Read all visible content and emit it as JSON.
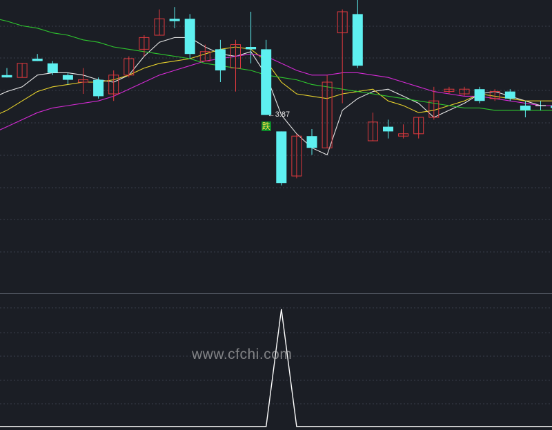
{
  "watermark": "www.cfchi.com",
  "colors": {
    "background": "#1b1e25",
    "grid": "#3a3f4a",
    "up": "#e0393e",
    "down": "#5ef0f0",
    "ma_white": "#e8e8e8",
    "ma_yellow": "#e8d22c",
    "ma_magenta": "#d62ad6",
    "ma_green": "#2ec82e",
    "signal_line": "#ffffff",
    "badge_bg": "#0a8a2a",
    "badge_text": "#ffe14a"
  },
  "chart_data": [
    {
      "type": "candlestick",
      "title": "",
      "ylim": [
        3.4,
        4.65
      ],
      "low_annotation": {
        "text": "3.87",
        "candle_index": 17
      },
      "signal_badge": {
        "text": "跌",
        "candle_index": 17
      },
      "candles": [
        {
          "o": 4.33,
          "c": 4.32,
          "h": 4.36,
          "l": 4.32
        },
        {
          "o": 4.32,
          "c": 4.38,
          "h": 4.38,
          "l": 4.32
        },
        {
          "o": 4.4,
          "c": 4.39,
          "h": 4.42,
          "l": 4.39
        },
        {
          "o": 4.38,
          "c": 4.34,
          "h": 4.39,
          "l": 4.33
        },
        {
          "o": 4.33,
          "c": 4.31,
          "h": 4.34,
          "l": 4.29
        },
        {
          "o": 4.3,
          "c": 4.31,
          "h": 4.36,
          "l": 4.25
        },
        {
          "o": 4.31,
          "c": 4.24,
          "h": 4.32,
          "l": 4.23
        },
        {
          "o": 4.25,
          "c": 4.33,
          "h": 4.35,
          "l": 4.22
        },
        {
          "o": 4.33,
          "c": 4.4,
          "h": 4.41,
          "l": 4.32
        },
        {
          "o": 4.44,
          "c": 4.49,
          "h": 4.5,
          "l": 4.41
        },
        {
          "o": 4.5,
          "c": 4.57,
          "h": 4.61,
          "l": 4.5
        },
        {
          "o": 4.57,
          "c": 4.56,
          "h": 4.62,
          "l": 4.53
        },
        {
          "o": 4.57,
          "c": 4.42,
          "h": 4.59,
          "l": 4.4
        },
        {
          "o": 4.39,
          "c": 4.43,
          "h": 4.46,
          "l": 4.39
        },
        {
          "o": 4.44,
          "c": 4.35,
          "h": 4.48,
          "l": 4.3
        },
        {
          "o": 4.36,
          "c": 4.46,
          "h": 4.48,
          "l": 4.26
        },
        {
          "o": 4.45,
          "c": 4.44,
          "h": 4.6,
          "l": 4.38
        },
        {
          "o": 4.44,
          "c": 4.16,
          "h": 4.48,
          "l": 4.16
        },
        {
          "o": 4.09,
          "c": 3.87,
          "h": 4.09,
          "l": 3.86
        },
        {
          "o": 3.9,
          "c": 4.07,
          "h": 4.08,
          "l": 3.89
        },
        {
          "o": 4.07,
          "c": 4.02,
          "h": 4.1,
          "l": 3.99
        },
        {
          "o": 4.02,
          "c": 4.3,
          "h": 4.33,
          "l": 4.02
        },
        {
          "o": 4.51,
          "c": 4.6,
          "h": 4.61,
          "l": 4.21
        },
        {
          "o": 4.59,
          "c": 4.37,
          "h": 4.65,
          "l": 4.36
        },
        {
          "o": 4.05,
          "c": 4.13,
          "h": 4.17,
          "l": 4.05
        },
        {
          "o": 4.11,
          "c": 4.09,
          "h": 4.14,
          "l": 4.06
        },
        {
          "o": 4.07,
          "c": 4.08,
          "h": 4.12,
          "l": 4.06
        },
        {
          "o": 4.08,
          "c": 4.15,
          "h": 4.15,
          "l": 4.06
        },
        {
          "o": 4.15,
          "c": 4.22,
          "h": 4.28,
          "l": 4.14
        },
        {
          "o": 4.26,
          "c": 4.27,
          "h": 4.28,
          "l": 4.25
        },
        {
          "o": 4.25,
          "c": 4.27,
          "h": 4.28,
          "l": 4.24
        },
        {
          "o": 4.27,
          "c": 4.22,
          "h": 4.28,
          "l": 4.21
        },
        {
          "o": 4.23,
          "c": 4.26,
          "h": 4.27,
          "l": 4.22
        },
        {
          "o": 4.26,
          "c": 4.23,
          "h": 4.27,
          "l": 4.22
        },
        {
          "o": 4.2,
          "c": 4.18,
          "h": 4.22,
          "l": 4.15
        },
        {
          "o": 4.2,
          "c": 4.2,
          "h": 4.22,
          "l": 4.18
        },
        {
          "o": 4.2,
          "c": 4.19,
          "h": 4.21,
          "l": 4.18
        }
      ],
      "moving_averages": [
        {
          "name": "",
          "color": "#e8e8e8",
          "values": [
            4.26,
            4.28,
            4.33,
            4.34,
            4.34,
            4.33,
            4.31,
            4.3,
            4.33,
            4.41,
            4.47,
            4.49,
            4.49,
            4.45,
            4.42,
            4.41,
            4.43,
            4.33,
            4.16,
            4.08,
            4.02,
            3.99,
            4.18,
            4.23,
            4.26,
            4.27,
            4.24,
            4.21,
            4.15,
            4.18,
            4.21,
            4.25,
            4.26,
            4.24,
            4.22,
            4.2,
            4.2
          ]
        },
        {
          "name": "",
          "color": "#e8d22c",
          "values": [
            4.18,
            4.22,
            4.26,
            4.28,
            4.29,
            4.3,
            4.3,
            4.31,
            4.33,
            4.36,
            4.38,
            4.39,
            4.4,
            4.42,
            4.44,
            4.45,
            4.44,
            4.39,
            4.3,
            4.25,
            4.24,
            4.23,
            4.25,
            4.26,
            4.27,
            4.22,
            4.2,
            4.17,
            4.18,
            4.2,
            4.22,
            4.25,
            4.24,
            4.23,
            4.22,
            4.22,
            4.22
          ]
        },
        {
          "name": "",
          "color": "#d62ad6",
          "values": [
            4.11,
            4.14,
            4.17,
            4.19,
            4.2,
            4.21,
            4.22,
            4.24,
            4.27,
            4.3,
            4.33,
            4.35,
            4.37,
            4.39,
            4.4,
            4.41,
            4.42,
            4.41,
            4.38,
            4.35,
            4.33,
            4.33,
            4.34,
            4.34,
            4.33,
            4.32,
            4.3,
            4.28,
            4.26,
            4.25,
            4.24,
            4.24,
            4.23,
            4.22,
            4.21,
            4.2,
            4.2
          ]
        },
        {
          "name": "",
          "color": "#2ec82e",
          "values": [
            4.56,
            4.54,
            4.53,
            4.51,
            4.5,
            4.48,
            4.47,
            4.45,
            4.44,
            4.43,
            4.42,
            4.41,
            4.4,
            4.38,
            4.37,
            4.36,
            4.35,
            4.33,
            4.32,
            4.31,
            4.29,
            4.28,
            4.27,
            4.26,
            4.25,
            4.24,
            4.23,
            4.22,
            4.21,
            4.2,
            4.19,
            4.19,
            4.18,
            4.18,
            4.18,
            4.18,
            4.18
          ]
        }
      ]
    },
    {
      "type": "line",
      "title": "",
      "ylim": [
        0,
        1
      ],
      "series": [
        {
          "name": "",
          "color": "#ffffff",
          "values": [
            0,
            0,
            0,
            0,
            0,
            0,
            0,
            0,
            0,
            0,
            0,
            0,
            0,
            0,
            0,
            0,
            0,
            0,
            1,
            0,
            0,
            0,
            0,
            0,
            0,
            0,
            0,
            0,
            0,
            0,
            0,
            0,
            0,
            0,
            0,
            0,
            0
          ]
        }
      ]
    }
  ]
}
